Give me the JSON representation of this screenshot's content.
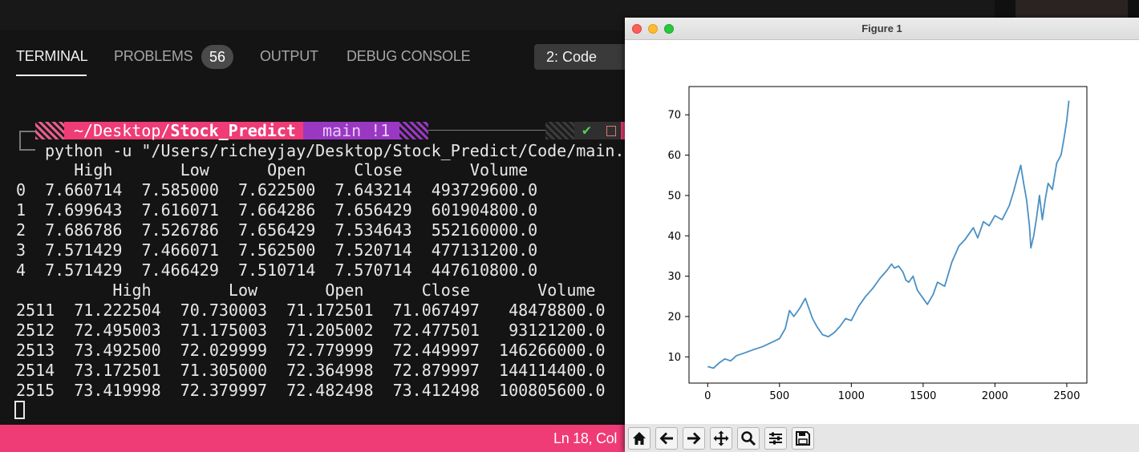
{
  "vscode": {
    "tabs": {
      "terminal": "TERMINAL",
      "problems": "PROBLEMS",
      "problems_count": "56",
      "output": "OUTPUT",
      "debug_console": "DEBUG CONSOLE"
    },
    "terminal_select": "2: Code",
    "prompt": {
      "path_prefix": "~/Desktop/",
      "path_bold": "Stock_Predict",
      "git": "main !1",
      "status_check": "✔"
    },
    "command": "python -u \"/Users/richeyjay/Desktop/Stock_Predict/Code/main.p",
    "head_header": "      High       Low      Open     Close       Volume",
    "head_rows": [
      "0  7.660714  7.585000  7.622500  7.643214  493729600.0",
      "1  7.699643  7.616071  7.664286  7.656429  601904800.0",
      "2  7.686786  7.526786  7.656429  7.534643  552160000.0",
      "3  7.571429  7.466071  7.562500  7.520714  477131200.0",
      "4  7.571429  7.466429  7.510714  7.570714  447610800.0"
    ],
    "tail_header": "          High        Low       Open      Close       Volume",
    "tail_rows": [
      "2511  71.222504  70.730003  71.172501  71.067497   48478800.0",
      "2512  72.495003  71.175003  71.205002  72.477501   93121200.0",
      "2513  73.492500  72.029999  72.779999  72.449997  146266000.0",
      "2514  73.172501  71.305000  72.364998  72.879997  144114400.0",
      "2515  73.419998  72.379997  72.482498  73.412498  100805600.0"
    ],
    "status_bar": "Ln 18, Col"
  },
  "figure": {
    "window_title": "Figure 1",
    "toolbar": [
      "home-icon",
      "back-icon",
      "forward-icon",
      "pan-icon",
      "zoom-icon",
      "configure-icon",
      "save-icon"
    ]
  },
  "chart_data": {
    "type": "line",
    "title": "",
    "xlabel": "",
    "ylabel": "",
    "xlim": [
      -130,
      2640
    ],
    "ylim": [
      3.5,
      77
    ],
    "xticks": [
      0,
      500,
      1000,
      1500,
      2000,
      2500
    ],
    "yticks": [
      10,
      20,
      30,
      40,
      50,
      60,
      70
    ],
    "grid": false,
    "color": "#4a90c4",
    "series": [
      {
        "x": [
          0,
          40,
          80,
          120,
          160,
          200,
          260,
          320,
          380,
          440,
          500,
          540,
          570,
          600,
          640,
          680,
          700,
          730,
          760,
          800,
          840,
          880,
          920,
          960,
          1000,
          1050,
          1100,
          1150,
          1200,
          1250,
          1280,
          1300,
          1330,
          1360,
          1380,
          1400,
          1430,
          1460,
          1500,
          1530,
          1570,
          1600,
          1650,
          1700,
          1750,
          1790,
          1820,
          1850,
          1880,
          1920,
          1960,
          2000,
          2050,
          2100,
          2130,
          2160,
          2180,
          2200,
          2220,
          2240,
          2250,
          2270,
          2290,
          2310,
          2330,
          2350,
          2370,
          2400,
          2430,
          2460,
          2480,
          2500,
          2515
        ],
        "y": [
          7.6,
          7.2,
          8.5,
          9.5,
          9.0,
          10.3,
          11.0,
          11.8,
          12.5,
          13.5,
          14.5,
          17.0,
          21.5,
          20.0,
          22.0,
          24.5,
          22.5,
          19.5,
          17.5,
          15.5,
          15.0,
          16.0,
          17.5,
          19.5,
          19.0,
          22.5,
          25.0,
          27.0,
          29.5,
          31.5,
          33.0,
          32.0,
          32.5,
          31.0,
          29.0,
          28.5,
          30.0,
          26.5,
          24.5,
          23.0,
          25.5,
          28.5,
          27.5,
          33.5,
          37.5,
          39.0,
          40.5,
          42.0,
          39.5,
          43.5,
          42.5,
          45.0,
          44.0,
          47.5,
          51.0,
          55.0,
          57.5,
          53.0,
          49.0,
          42.5,
          37.0,
          40.0,
          44.5,
          50.0,
          44.0,
          49.0,
          53.0,
          51.5,
          58.0,
          60.0,
          64.0,
          68.5,
          73.5
        ]
      }
    ]
  }
}
